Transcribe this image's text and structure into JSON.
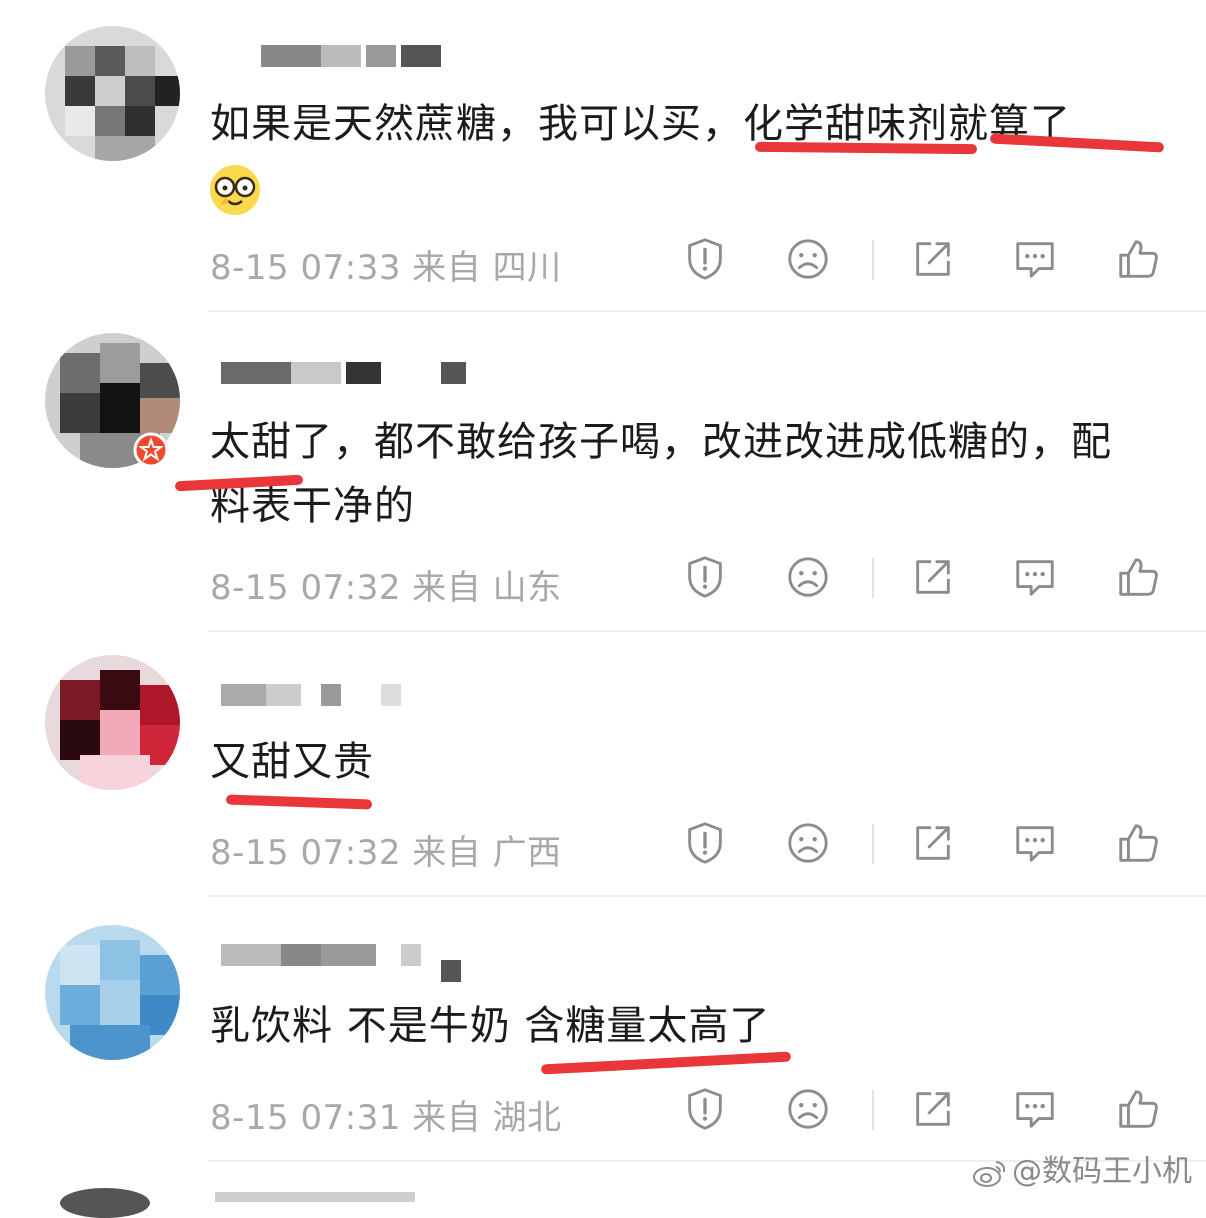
{
  "comments": [
    {
      "text": "如果是天然蔗糖，我可以买，化学甜味剂就算了",
      "emoji": "glasses-face-emoji",
      "time": "8-15 07:33",
      "from_label": "来自",
      "location": "四川"
    },
    {
      "text": "太甜了，都不敢给孩子喝，改进改进成低糖的，配料表干净的",
      "time": "8-15 07:32",
      "from_label": "来自",
      "location": "山东"
    },
    {
      "text": "又甜又贵",
      "time": "8-15 07:32",
      "from_label": "来自",
      "location": "广西"
    },
    {
      "text": "乳饮料 不是牛奶 含糖量太高了",
      "time": "8-15 07:31",
      "from_label": "来自",
      "location": "湖北"
    }
  ],
  "actions": [
    "report-icon",
    "dislike-icon",
    "share-icon",
    "reply-icon",
    "like-icon"
  ],
  "colors": {
    "underline": "#e8363a",
    "meta": "#a8a8a8",
    "text": "#1b1b1b",
    "badge": "#f04a2e"
  },
  "watermark": "@数码王小机"
}
